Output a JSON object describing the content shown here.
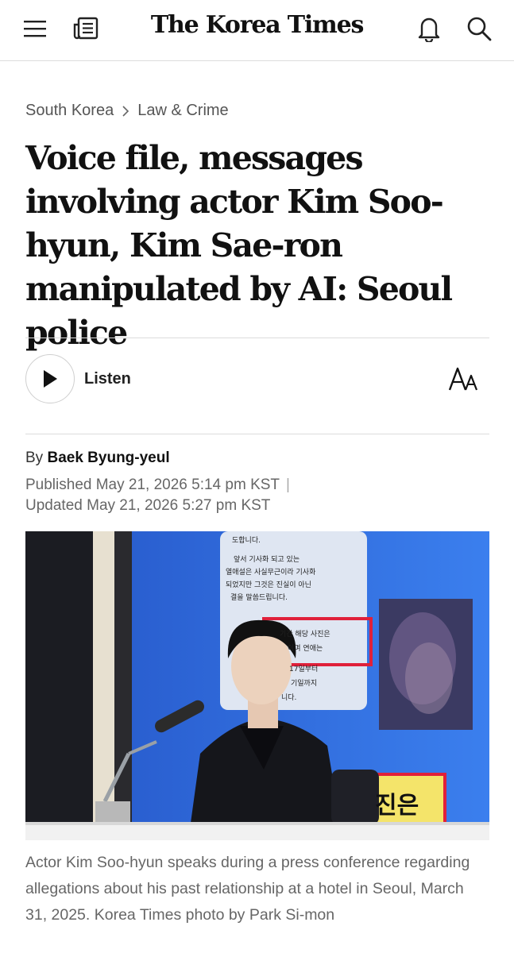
{
  "header": {
    "logo": "The Korea Times",
    "menu_icon": "hamburger-menu-icon",
    "news_icon": "newspaper-icon",
    "notify_icon": "bell-icon",
    "search_icon": "search-icon"
  },
  "breadcrumb": {
    "section": "South Korea",
    "subsection": "Law & Crime"
  },
  "article": {
    "headline": "Voice file, messages involving actor Kim Soo-hyun, Kim Sae-ron manipulated by AI: Seoul police",
    "listen_label": "Listen",
    "font_size_icon": "font-size-icon",
    "byline_prefix": "By",
    "author": "Baek Byung-yeul",
    "published": "Published May 21, 2026 5:14 pm KST",
    "published_divider": "|",
    "updated": "Updated May 21, 2026 5:27 pm KST"
  },
  "photo": {
    "screen_text_bottom": "진은",
    "screen_lines": [
      "도합니다.",
      "앞서 기사화 되고 있는",
      "열애설은 사실무근이라 기사화",
      "되었지만 그것은 진실이 아닌",
      "결을 말씀드립니다.",
      "기간 해당 사진은",
      "이며 연애는",
      "17일부터",
      "기일까지",
      "니다."
    ],
    "caption": "Actor Kim Soo-hyun speaks during a press conference regarding allegations about his past relationship at a hotel in Seoul, March 31, 2025. Korea Times photo by Park Si-mon"
  },
  "colors": {
    "text": "#111111",
    "muted": "#666666",
    "divider": "#dcdcdc",
    "screen_blue": "#2f6fe0",
    "highlight_red": "#e0203a"
  }
}
